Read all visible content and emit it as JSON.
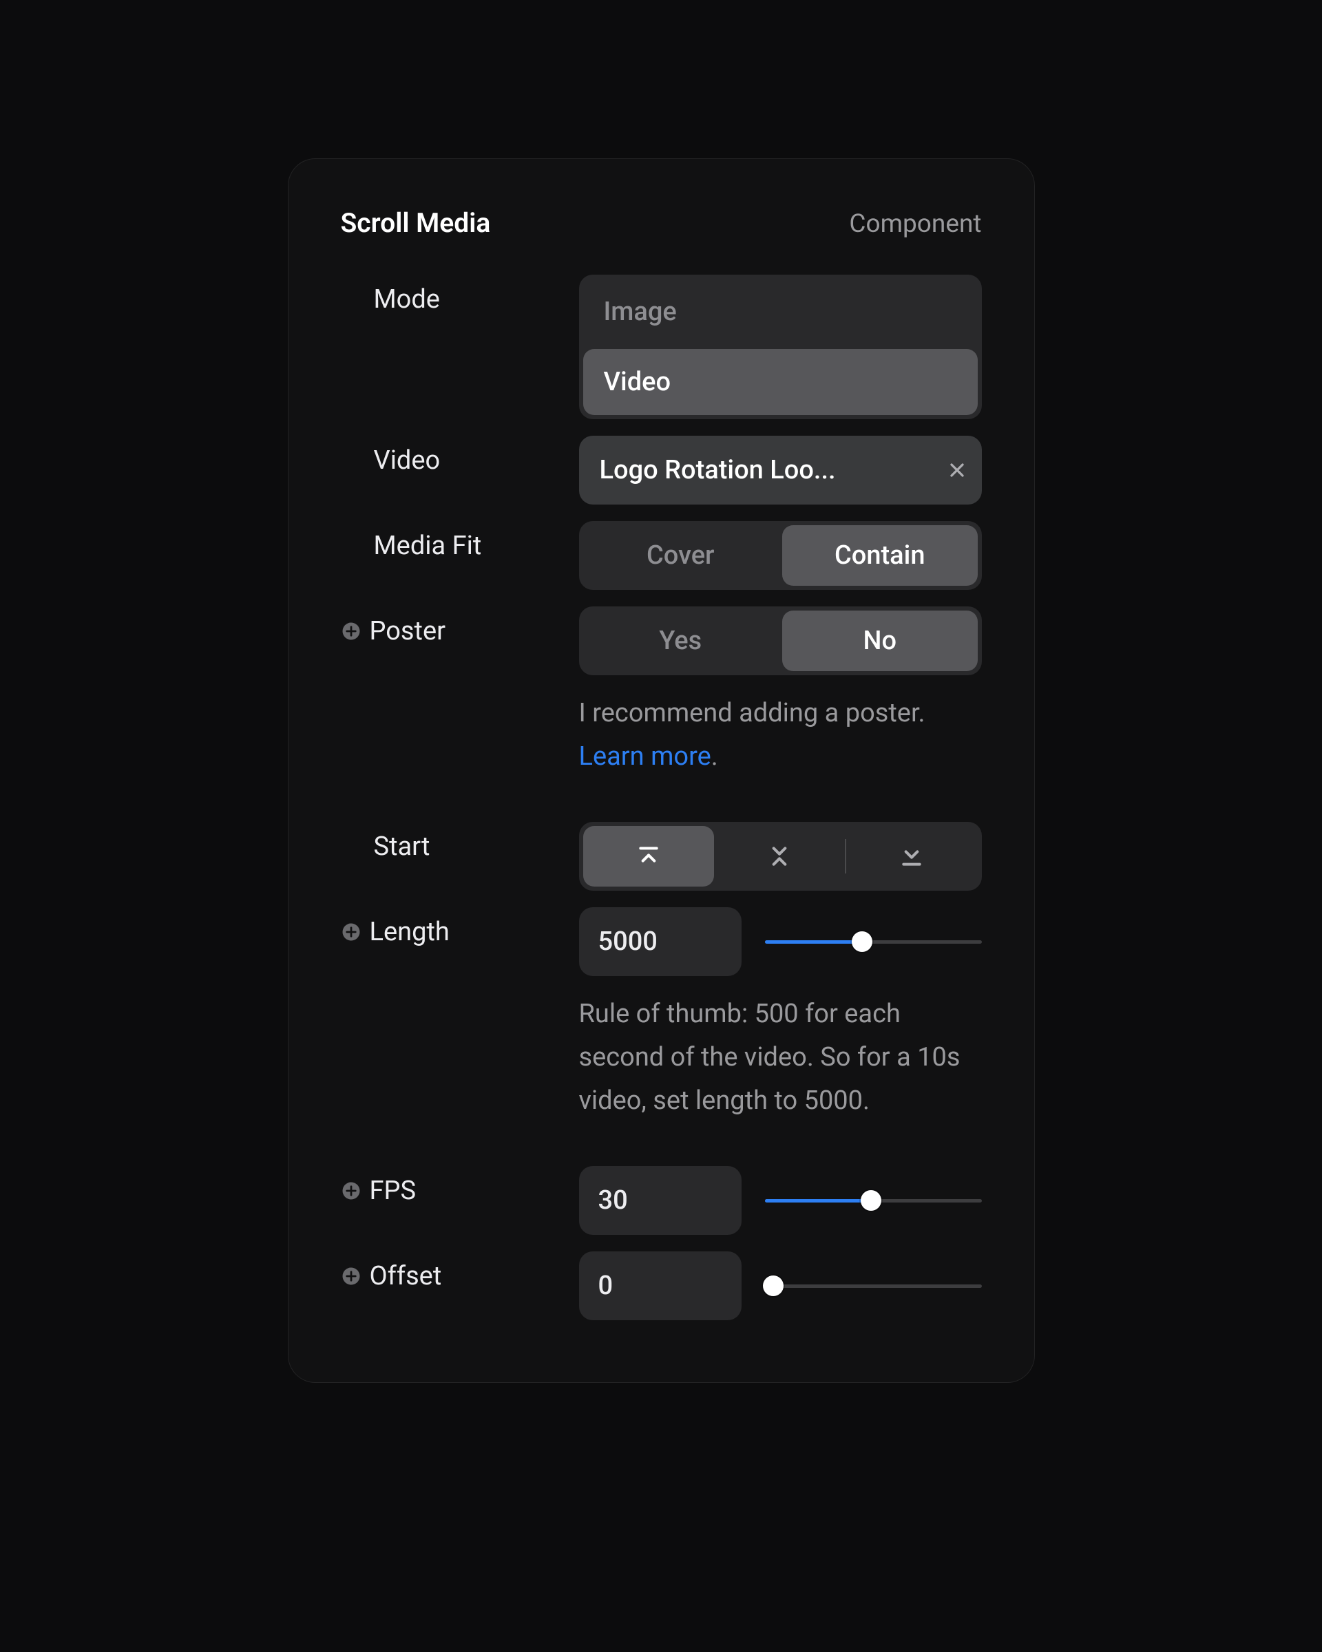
{
  "header": {
    "title": "Scroll Media",
    "badge": "Component"
  },
  "mode": {
    "label": "Mode",
    "options": {
      "image": "Image",
      "video": "Video"
    },
    "selected": "video"
  },
  "video": {
    "label": "Video",
    "value": "Logo Rotation Loo..."
  },
  "mediaFit": {
    "label": "Media Fit",
    "options": {
      "cover": "Cover",
      "contain": "Contain"
    },
    "selected": "contain"
  },
  "poster": {
    "label": "Poster",
    "options": {
      "yes": "Yes",
      "no": "No"
    },
    "selected": "no",
    "helperPrefix": "I recommend adding a poster. ",
    "helperLink": "Learn more",
    "helperSuffix": "."
  },
  "start": {
    "label": "Start"
  },
  "length": {
    "label": "Length",
    "value": "5000",
    "percent": 45,
    "helper": "Rule of thumb: 500 for each second of the video. So for a 10s video, set length to 5000."
  },
  "fps": {
    "label": "FPS",
    "value": "30",
    "percent": 49
  },
  "offset": {
    "label": "Offset",
    "value": "0",
    "percent": 4
  }
}
